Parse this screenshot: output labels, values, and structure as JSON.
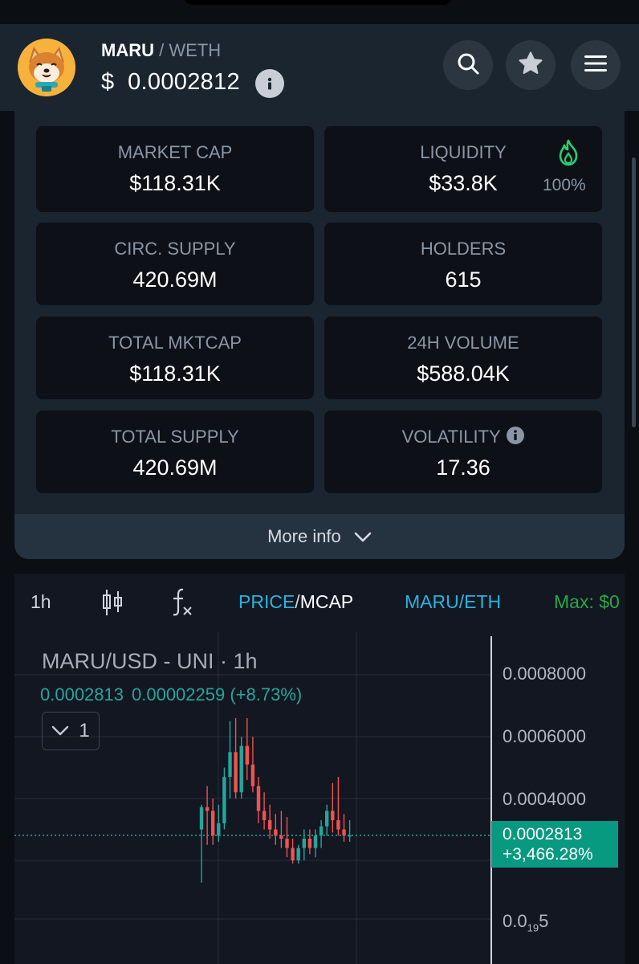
{
  "header": {
    "base_symbol": "MARU",
    "separator": " / ",
    "quote_symbol": "WETH",
    "price": "$  0.0002812"
  },
  "stats": [
    {
      "label": "MARKET CAP",
      "value": "$118.31K"
    },
    {
      "label": "LIQUIDITY",
      "value": "$33.8K",
      "extra": "100%"
    },
    {
      "label": "CIRC. SUPPLY",
      "value": "420.69M"
    },
    {
      "label": "HOLDERS",
      "value": "615"
    },
    {
      "label": "TOTAL MKTCAP",
      "value": "$118.31K"
    },
    {
      "label": "24H VOLUME",
      "value": "$588.04K"
    },
    {
      "label": "TOTAL SUPPLY",
      "value": "420.69M"
    },
    {
      "label": "VOLATILITY",
      "value": "17.36"
    }
  ],
  "more_info_label": "More info",
  "toolbar": {
    "interval": "1h",
    "price_label": "PRICE",
    "slash": "/",
    "mcap_label": "MCAP",
    "pair_toggle": "MARU/ETH",
    "max_label": "Max: $0"
  },
  "chart": {
    "title": "MARU/USD - UNI · 1h",
    "ohlc_price": "0.0002813",
    "ohlc_change": "0.00002259 (+8.73%)",
    "collapse_count": "1",
    "y_ticks": [
      "0.0008000",
      "0.0006000",
      "0.0004000"
    ],
    "y_tick_low": "0.0",
    "y_tick_low_sub": "19",
    "y_tick_low_end": "5",
    "last_price": "0.0002813",
    "last_change": "+3,466.28%"
  },
  "colors": {
    "up": "#26a69a",
    "down": "#ef5350",
    "accent_blue": "#2bb3d9",
    "max_green": "#27a844",
    "flame_green": "#2ecc71"
  },
  "chart_data": {
    "type": "candlestick",
    "title": "MARU/USD - UNI · 1h",
    "ylim": [
      0.00015,
      0.00088
    ],
    "y_ticks": [
      0.0008,
      0.0006,
      0.0004
    ],
    "last": 0.0002813,
    "candles": [
      {
        "o": 0.0003,
        "h": 0.00038,
        "l": 0.000128,
        "c": 0.000372
      },
      {
        "o": 0.000372,
        "h": 0.00044,
        "l": 0.00025,
        "c": 0.00036
      },
      {
        "o": 0.00036,
        "h": 0.0004,
        "l": 0.00025,
        "c": 0.00028
      },
      {
        "o": 0.00028,
        "h": 0.00038,
        "l": 0.00026,
        "c": 0.00032
      },
      {
        "o": 0.00032,
        "h": 0.0005,
        "l": 0.0003,
        "c": 0.00047
      },
      {
        "o": 0.00047,
        "h": 0.00065,
        "l": 0.0004,
        "c": 0.00055
      },
      {
        "o": 0.00055,
        "h": 0.00066,
        "l": 0.0004,
        "c": 0.00042
      },
      {
        "o": 0.00042,
        "h": 0.0006,
        "l": 0.0004,
        "c": 0.00057
      },
      {
        "o": 0.00057,
        "h": 0.00066,
        "l": 0.00046,
        "c": 0.00051
      },
      {
        "o": 0.00051,
        "h": 0.0006,
        "l": 0.00042,
        "c": 0.00044
      },
      {
        "o": 0.00044,
        "h": 0.00047,
        "l": 0.00032,
        "c": 0.00036
      },
      {
        "o": 0.00036,
        "h": 0.00042,
        "l": 0.0003,
        "c": 0.00033
      },
      {
        "o": 0.00033,
        "h": 0.00038,
        "l": 0.00027,
        "c": 0.0003
      },
      {
        "o": 0.0003,
        "h": 0.00035,
        "l": 0.00025,
        "c": 0.00028
      },
      {
        "o": 0.00028,
        "h": 0.00036,
        "l": 0.00024,
        "c": 0.00027
      },
      {
        "o": 0.00027,
        "h": 0.00034,
        "l": 0.00021,
        "c": 0.00024
      },
      {
        "o": 0.00024,
        "h": 0.00027,
        "l": 0.00019,
        "c": 0.0002
      },
      {
        "o": 0.0002,
        "h": 0.00025,
        "l": 0.00019,
        "c": 0.00024
      },
      {
        "o": 0.00024,
        "h": 0.0003,
        "l": 0.0002,
        "c": 0.00027
      },
      {
        "o": 0.00027,
        "h": 0.0003,
        "l": 0.00022,
        "c": 0.00024
      },
      {
        "o": 0.00024,
        "h": 0.0003,
        "l": 0.00021,
        "c": 0.00028
      },
      {
        "o": 0.00028,
        "h": 0.00033,
        "l": 0.00024,
        "c": 0.00031
      },
      {
        "o": 0.00031,
        "h": 0.00038,
        "l": 0.00028,
        "c": 0.00036
      },
      {
        "o": 0.00036,
        "h": 0.00045,
        "l": 0.00029,
        "c": 0.00033
      },
      {
        "o": 0.00033,
        "h": 0.00047,
        "l": 0.00028,
        "c": 0.0003
      },
      {
        "o": 0.0003,
        "h": 0.00035,
        "l": 0.00026,
        "c": 0.00028
      },
      {
        "o": 0.00028,
        "h": 0.00033,
        "l": 0.00026,
        "c": 0.000281
      }
    ]
  }
}
